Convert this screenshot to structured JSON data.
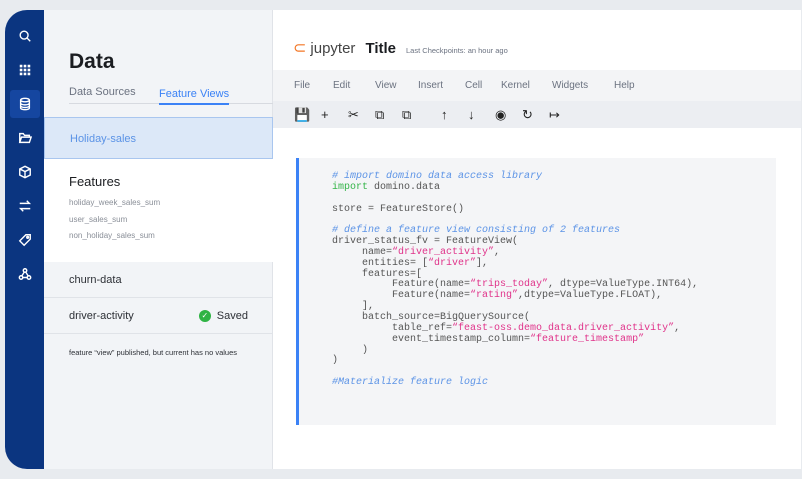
{
  "sidebar": {
    "icons": [
      "search-icon",
      "grid-icon",
      "database-icon",
      "folder-icon",
      "cube-icon",
      "transfer-icon",
      "tag-icon",
      "network-icon"
    ],
    "active": "database-icon"
  },
  "panel": {
    "title": "Data",
    "tabs": [
      "Data Sources",
      "Feature Views"
    ],
    "active_tab": "Feature Views",
    "selected": "Holiday-sales",
    "features_title": "Features",
    "features": [
      "holiday_week_sales_sum",
      "user_sales_sum",
      "non_holiday_sales_sum"
    ],
    "items": [
      {
        "label": "churn-data"
      },
      {
        "label": "driver-activity",
        "status": "Saved"
      }
    ],
    "note": "feature “view” published, but current has no values"
  },
  "notebook": {
    "logo": "jupyter",
    "title": "Title",
    "checkpoint": "Last Checkpoints: an hour ago",
    "menu": [
      "File",
      "Edit",
      "View",
      "Insert",
      "Cell",
      "Kernel",
      "Widgets",
      "Help"
    ],
    "toolbar": [
      {
        "icon": "save-icon",
        "glyph": "💾"
      },
      {
        "icon": "plus-icon",
        "glyph": "+"
      },
      {
        "icon": "scissors-icon",
        "glyph": "✂"
      },
      {
        "icon": "copy-icon",
        "glyph": "⧉"
      },
      {
        "icon": "paste-icon",
        "glyph": "⧉"
      },
      {
        "icon": "arrow-up-icon",
        "glyph": "↑"
      },
      {
        "icon": "arrow-down-icon",
        "glyph": "↓"
      },
      {
        "icon": "stop-icon",
        "glyph": "◉"
      },
      {
        "icon": "restart-icon",
        "glyph": "↻"
      },
      {
        "icon": "run-icon",
        "glyph": "↦"
      }
    ],
    "code": [
      [
        [
          "comment",
          "# import domino data access library"
        ]
      ],
      [
        [
          "keyword",
          "import"
        ],
        [
          "plain",
          " domino.data"
        ]
      ],
      [],
      [
        [
          "plain",
          "store = FeatureStore()"
        ]
      ],
      [],
      [
        [
          "comment",
          "# define a feature view consisting of 2 features"
        ]
      ],
      [
        [
          "plain",
          "driver_status_fv = FeatureView("
        ]
      ],
      [
        [
          "plain",
          "     name="
        ],
        [
          "string",
          "“driver_activity”"
        ],
        [
          "plain",
          ","
        ]
      ],
      [
        [
          "plain",
          "     entities= ["
        ],
        [
          "string",
          "“driver”"
        ],
        [
          "plain",
          "],"
        ]
      ],
      [
        [
          "plain",
          "     features=["
        ]
      ],
      [
        [
          "plain",
          "          Feature(name="
        ],
        [
          "string",
          "“trips_today”"
        ],
        [
          "plain",
          ", dtype=ValueType.INT64),"
        ]
      ],
      [
        [
          "plain",
          "          Feature(name="
        ],
        [
          "string",
          "“rating”"
        ],
        [
          "plain",
          ",dtype=ValueType.FLOAT),"
        ]
      ],
      [
        [
          "plain",
          "     ],"
        ]
      ],
      [
        [
          "plain",
          "     batch_source=BigQuerySource("
        ]
      ],
      [
        [
          "plain",
          "          table_ref="
        ],
        [
          "string",
          "“feast-oss.demo_data.driver_activity”"
        ],
        [
          "plain",
          ","
        ]
      ],
      [
        [
          "plain",
          "          event_timestamp_column="
        ],
        [
          "string",
          "“feature_timestamp”"
        ]
      ],
      [
        [
          "plain",
          "     )"
        ]
      ],
      [
        [
          "plain",
          ")"
        ]
      ],
      [],
      [
        [
          "comment",
          "#Materialize feature logic"
        ]
      ]
    ]
  },
  "colors": {
    "rail": "#0b3580",
    "accent": "#3b82f6",
    "string": "#e0338a",
    "keyword": "#35b54a",
    "saved": "#2fb344",
    "jupyter": "#f37726"
  }
}
